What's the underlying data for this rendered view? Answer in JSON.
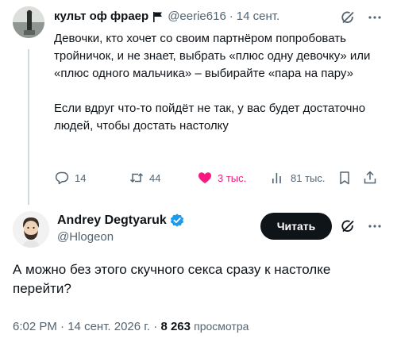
{
  "parent_tweet": {
    "author_name": "культ оф фраер",
    "handle": "@eerie616",
    "separator": "·",
    "time": "14 сент.",
    "text_paragraphs": [
      "Девочки, кто хочет со своим партнёром попробовать тройничок, и не знает, выбрать «плюс одну девочку» или «плюс одного мальчика» – выбирайте «пара на пару»",
      "Если вдруг что-то пойдёт не так, у вас будет достаточно людей, чтобы достать настолку"
    ],
    "stats": {
      "replies": "14",
      "reposts": "44",
      "likes": "3 тыс.",
      "views": "81 тыс."
    },
    "icons": [
      "flag-icon",
      "grok-icon",
      "more-icon",
      "reply-icon",
      "repost-icon",
      "heart-icon",
      "views-icon",
      "bookmark-icon",
      "share-icon"
    ]
  },
  "main_tweet": {
    "author_name": "Andrey Degtyaruk",
    "handle": "@Hlogeon",
    "follow_label": "Читать",
    "text": "А можно без этого скучного секса сразу к настолке перейти?",
    "time": "6:02 PM",
    "separator": "·",
    "date": "14 сент. 2026 г.",
    "views_count": "8 263",
    "views_label": "просмотра"
  },
  "colors": {
    "text_primary": "#0f1419",
    "text_secondary": "#536471",
    "like_pink": "#f91880",
    "verified_blue": "#1d9bf0",
    "thread_line": "#cfd9de"
  }
}
